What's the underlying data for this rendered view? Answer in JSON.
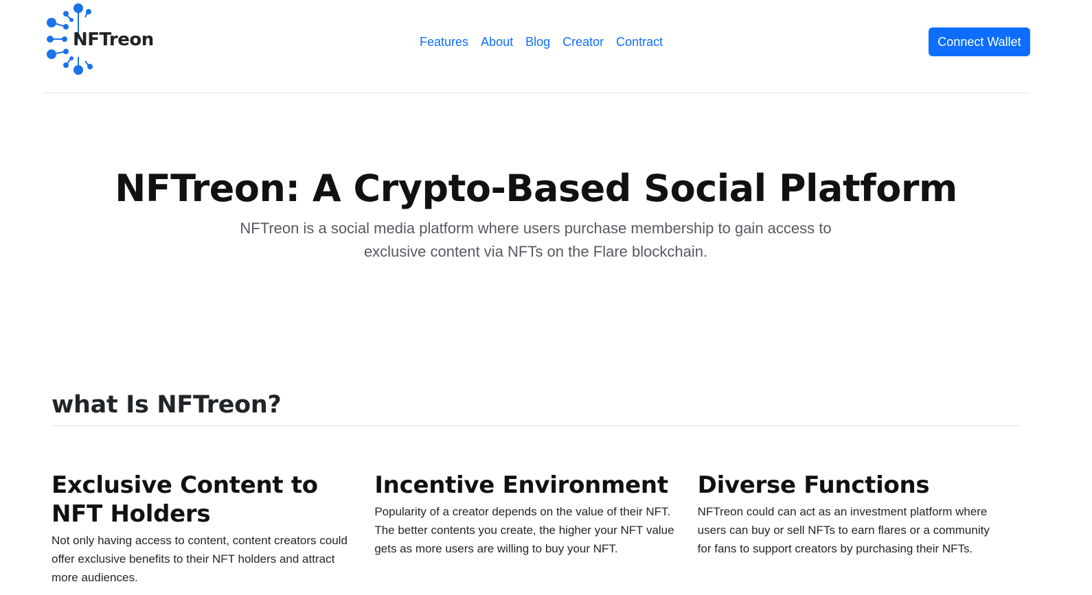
{
  "header": {
    "logo_text": "NFTreon",
    "nav": [
      {
        "label": "Features"
      },
      {
        "label": "About"
      },
      {
        "label": "Blog"
      },
      {
        "label": "Creator"
      },
      {
        "label": "Contract"
      }
    ],
    "connect_label": "Connect Wallet"
  },
  "hero": {
    "title": "NFTreon: A Crypto-Based Social Platform",
    "lead": "NFTreon is a social media platform where users purchase membership to gain access to exclusive content via NFTs on the Flare blockchain."
  },
  "section": {
    "title": "what Is NFTreon?",
    "features": [
      {
        "title": "Exclusive Content to NFT Holders",
        "text": "Not only having access to content, content creators could offer exclusive benefits to their NFT holders and attract more audiences."
      },
      {
        "title": "Incentive Environment",
        "text": "Popularity of a creator depends on the value of their NFT. The better contents you create, the higher your NFT value gets as more users are willing to buy your NFT."
      },
      {
        "title": "Diverse Functions",
        "text": "NFTreon could can act as an investment platform where users can buy or sell NFTs to earn flares or a community for fans to support creators by purchasing their NFTs."
      }
    ]
  },
  "colors": {
    "accent": "#0d6efd",
    "logo_blue": "#1a73e8"
  }
}
